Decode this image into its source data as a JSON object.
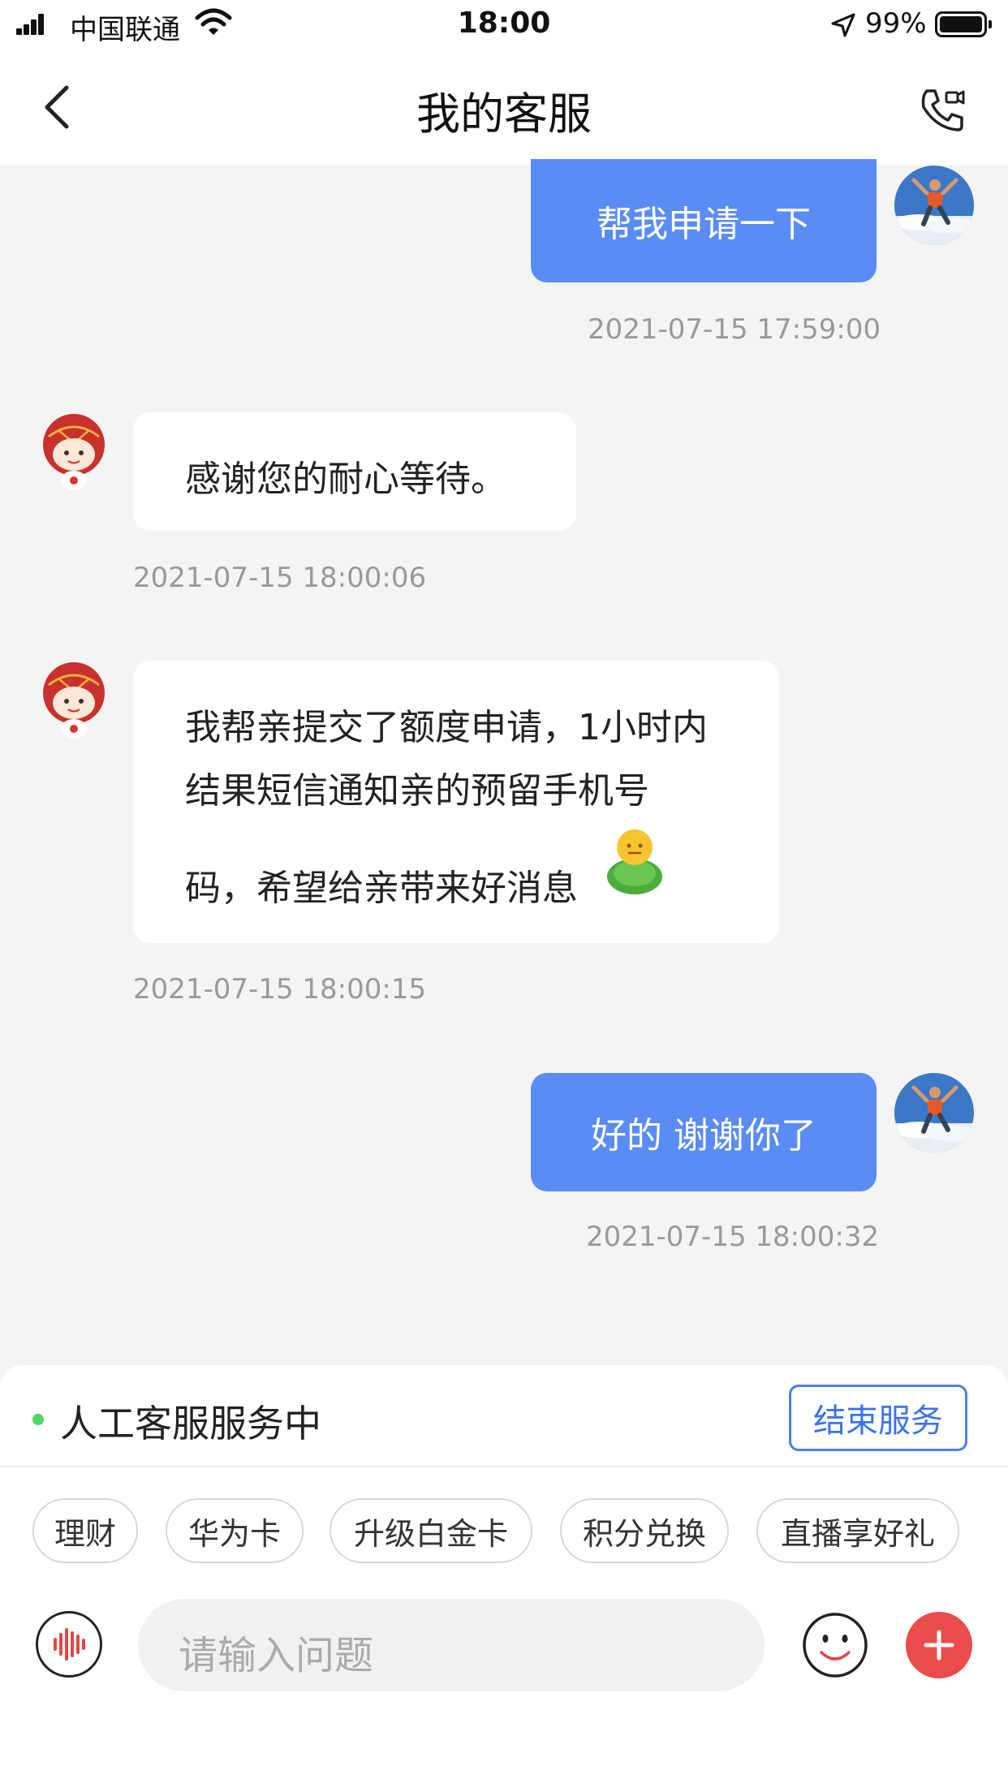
{
  "status_bar": {
    "carrier": "中国联通",
    "time": "18:00",
    "battery": "99%"
  },
  "nav": {
    "title": "我的客服"
  },
  "messages": [
    {
      "side": "out",
      "text": "帮我申请一下",
      "time": "2021-07-15 17:59:00"
    },
    {
      "side": "in",
      "text": "感谢您的耐心等待。",
      "time": "2021-07-15 18:00:06"
    },
    {
      "side": "in",
      "lines": [
        "我帮亲提交了额度申请，1小时内",
        "结果短信通知亲的预留手机号",
        "码，希望给亲带来好消息"
      ],
      "time": "2021-07-15 18:00:15"
    },
    {
      "side": "out",
      "text": "好的 谢谢你了",
      "time": "2021-07-15 18:00:32"
    }
  ],
  "service": {
    "status": "人工客服服务中",
    "end_label": "结束服务"
  },
  "quick_chips": [
    "理财",
    "华为卡",
    "升级白金卡",
    "积分兑换",
    "直播享好礼"
  ],
  "input": {
    "placeholder": "请输入问题"
  },
  "colors": {
    "outgoing_bubble": "#5b8cf5",
    "accent_blue": "#3b73ef",
    "plus_red": "#ea4b4b",
    "online_green": "#4cd964"
  },
  "icons": [
    "back-icon",
    "video-call-icon",
    "voice-icon",
    "emoji-icon",
    "plus-icon"
  ]
}
